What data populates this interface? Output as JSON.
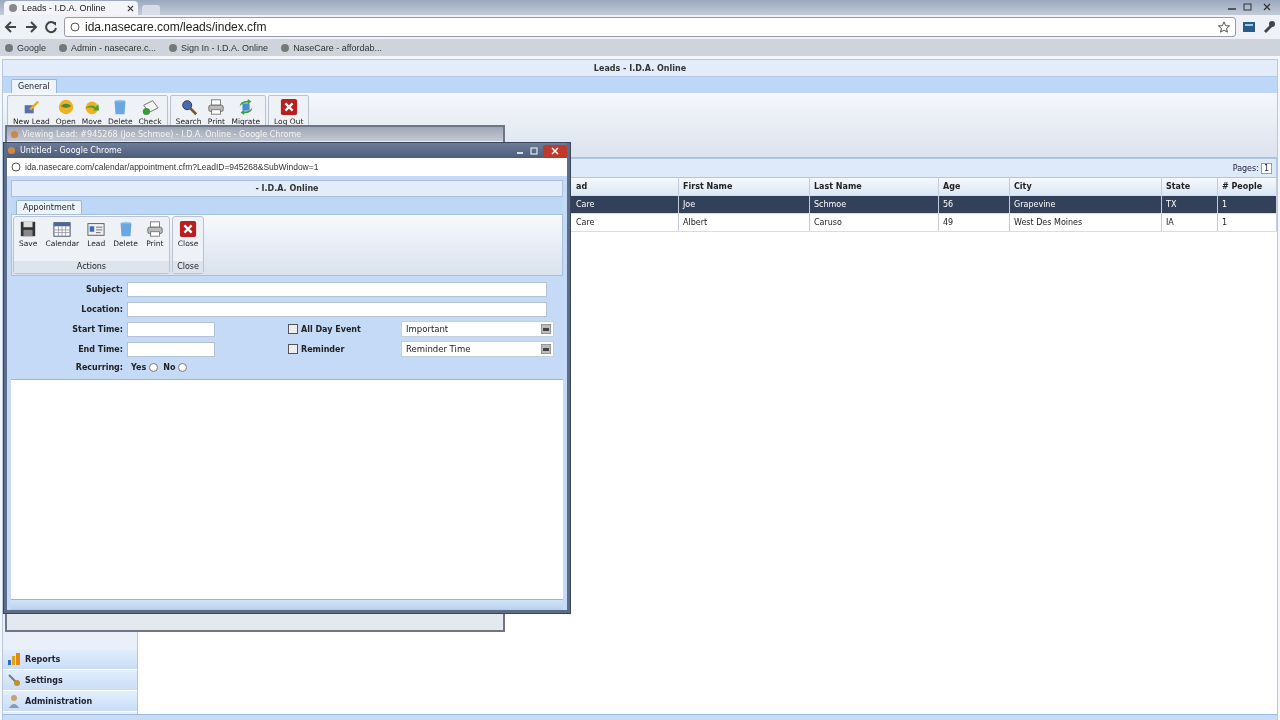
{
  "browser": {
    "tabs": [
      {
        "title": "Leads - I.D.A. Online",
        "selected": true
      }
    ],
    "url": "ida.nasecare.com/leads/index.cfm",
    "bookmarks": [
      "Google",
      "Admin - nasecare.c...",
      "Sign In - I.D.A. Online",
      "NaseCare - affordab..."
    ]
  },
  "app": {
    "title": "Leads - I.D.A. Online",
    "tabs": [
      {
        "label": "General",
        "selected": true
      }
    ],
    "toolbar": [
      [
        {
          "label": "New Lead",
          "kind": "newlead"
        },
        {
          "label": "Open",
          "kind": "open"
        },
        {
          "label": "Move",
          "kind": "move"
        },
        {
          "label": "Delete",
          "kind": "delete"
        },
        {
          "label": "Check",
          "kind": "check"
        }
      ],
      [
        {
          "label": "Search",
          "kind": "search"
        },
        {
          "label": "Print",
          "kind": "print"
        },
        {
          "label": "Migrate",
          "kind": "migrate"
        }
      ],
      [
        {
          "label": "Log Out",
          "kind": "close"
        }
      ]
    ],
    "sidebar": [
      {
        "label": "Reports",
        "kind": "reports"
      },
      {
        "label": "Settings",
        "kind": "settings"
      },
      {
        "label": "Administration",
        "kind": "admin"
      }
    ],
    "grid": {
      "pages_label": "Pages:",
      "page": "1",
      "columns": [
        "ad",
        "First Name",
        "Last Name",
        "Age",
        "City",
        "State",
        "# People"
      ],
      "rows": [
        {
          "selected": true,
          "cells": [
            "Care",
            "Joe",
            "Schmoe",
            "56",
            "Grapevine",
            "TX",
            "1"
          ]
        },
        {
          "selected": false,
          "cells": [
            "Care",
            "Albert",
            "Caruso",
            "49",
            "West Des Moines",
            "IA",
            "1"
          ]
        }
      ]
    }
  },
  "back_window": {
    "title": "Viewing Lead: #945268 (Joe Schmoe) - I.D.A. Online - Google Chrome"
  },
  "popup": {
    "title": "Untitled - Google Chrome",
    "url": "ida.nasecare.com/calendar/appointment.cfm?LeadID=945268&SubWindow=1",
    "header": "- I.D.A. Online",
    "tabs": [
      {
        "label": "Appointment",
        "selected": true
      }
    ],
    "groups": [
      {
        "label": "Actions",
        "buttons": [
          {
            "label": "Save",
            "kind": "save"
          },
          {
            "label": "Calendar",
            "kind": "calendar"
          },
          {
            "label": "Lead",
            "kind": "lead"
          },
          {
            "label": "Delete",
            "kind": "delete"
          },
          {
            "label": "Print",
            "kind": "print"
          }
        ]
      },
      {
        "label": "Close",
        "buttons": [
          {
            "label": "Close",
            "kind": "close"
          }
        ]
      }
    ],
    "form": {
      "subject": {
        "label": "Subject:"
      },
      "location": {
        "label": "Location:"
      },
      "start_time": {
        "label": "Start Time:"
      },
      "end_time": {
        "label": "End Time:"
      },
      "all_day": {
        "label": "All Day Event",
        "checked": false
      },
      "reminder": {
        "label": "Reminder",
        "checked": false
      },
      "priority": {
        "value": "Important"
      },
      "reminder_time": {
        "value": "Reminder Time"
      },
      "recurring": {
        "label": "Recurring:",
        "options": [
          {
            "label": "Yes",
            "selected": false
          },
          {
            "label": "No",
            "selected": false
          }
        ]
      }
    }
  }
}
